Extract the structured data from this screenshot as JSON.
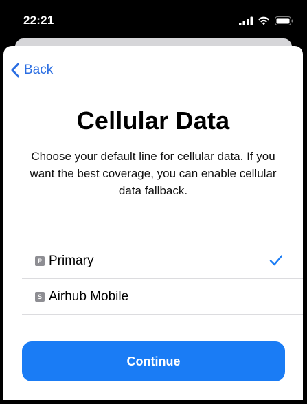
{
  "status_bar": {
    "time": "22:21"
  },
  "navigation": {
    "back_label": "Back"
  },
  "header": {
    "title": "Cellular Data",
    "subtitle": "Choose your default line for cellular data. If you want the best coverage, you can enable cellular data fallback."
  },
  "options": [
    {
      "badge": "P",
      "label": "Primary",
      "selected": true
    },
    {
      "badge": "S",
      "label": "Airhub Mobile",
      "selected": false
    }
  ],
  "footer": {
    "continue_label": "Continue"
  },
  "colors": {
    "accent": "#1a7cf5",
    "link": "#2b6ee2",
    "badge": "#8e8e93"
  }
}
